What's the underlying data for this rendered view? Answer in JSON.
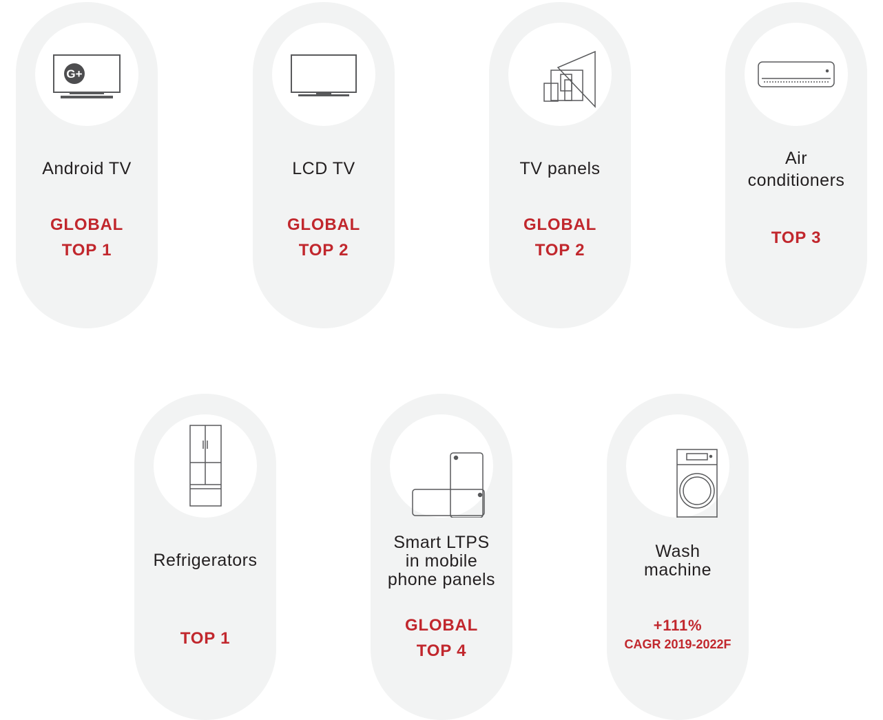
{
  "colors": {
    "pill": "#f2f3f3",
    "icon_bg": "#ffffff",
    "label": "#231f20",
    "rank": "#c1272d",
    "icon_stroke": "#58595b"
  },
  "items": [
    {
      "icon": "android-tv-icon",
      "label": [
        "Android TV"
      ],
      "rank": [
        "GLOBAL",
        "TOP 1"
      ]
    },
    {
      "icon": "lcd-tv-icon",
      "label": [
        "LCD TV"
      ],
      "rank": [
        "GLOBAL",
        "TOP 2"
      ]
    },
    {
      "icon": "tv-panels-icon",
      "label": [
        "TV panels"
      ],
      "rank": [
        "GLOBAL",
        "TOP 2"
      ]
    },
    {
      "icon": "air-conditioner-icon",
      "label": [
        "Air",
        "conditioners"
      ],
      "rank": [
        "TOP 3"
      ]
    },
    {
      "icon": "refrigerator-icon",
      "label": [
        "Refrigerators"
      ],
      "rank": [
        "TOP 1"
      ]
    },
    {
      "icon": "smartphone-icon",
      "label": [
        "Smart LTPS",
        "in mobile",
        "phone panels"
      ],
      "rank": [
        "GLOBAL",
        "TOP 4"
      ]
    },
    {
      "icon": "wash-machine-icon",
      "label": [
        "Wash",
        "machine"
      ],
      "rank": [
        "+111%",
        "CAGR 2019-2022F"
      ]
    }
  ]
}
